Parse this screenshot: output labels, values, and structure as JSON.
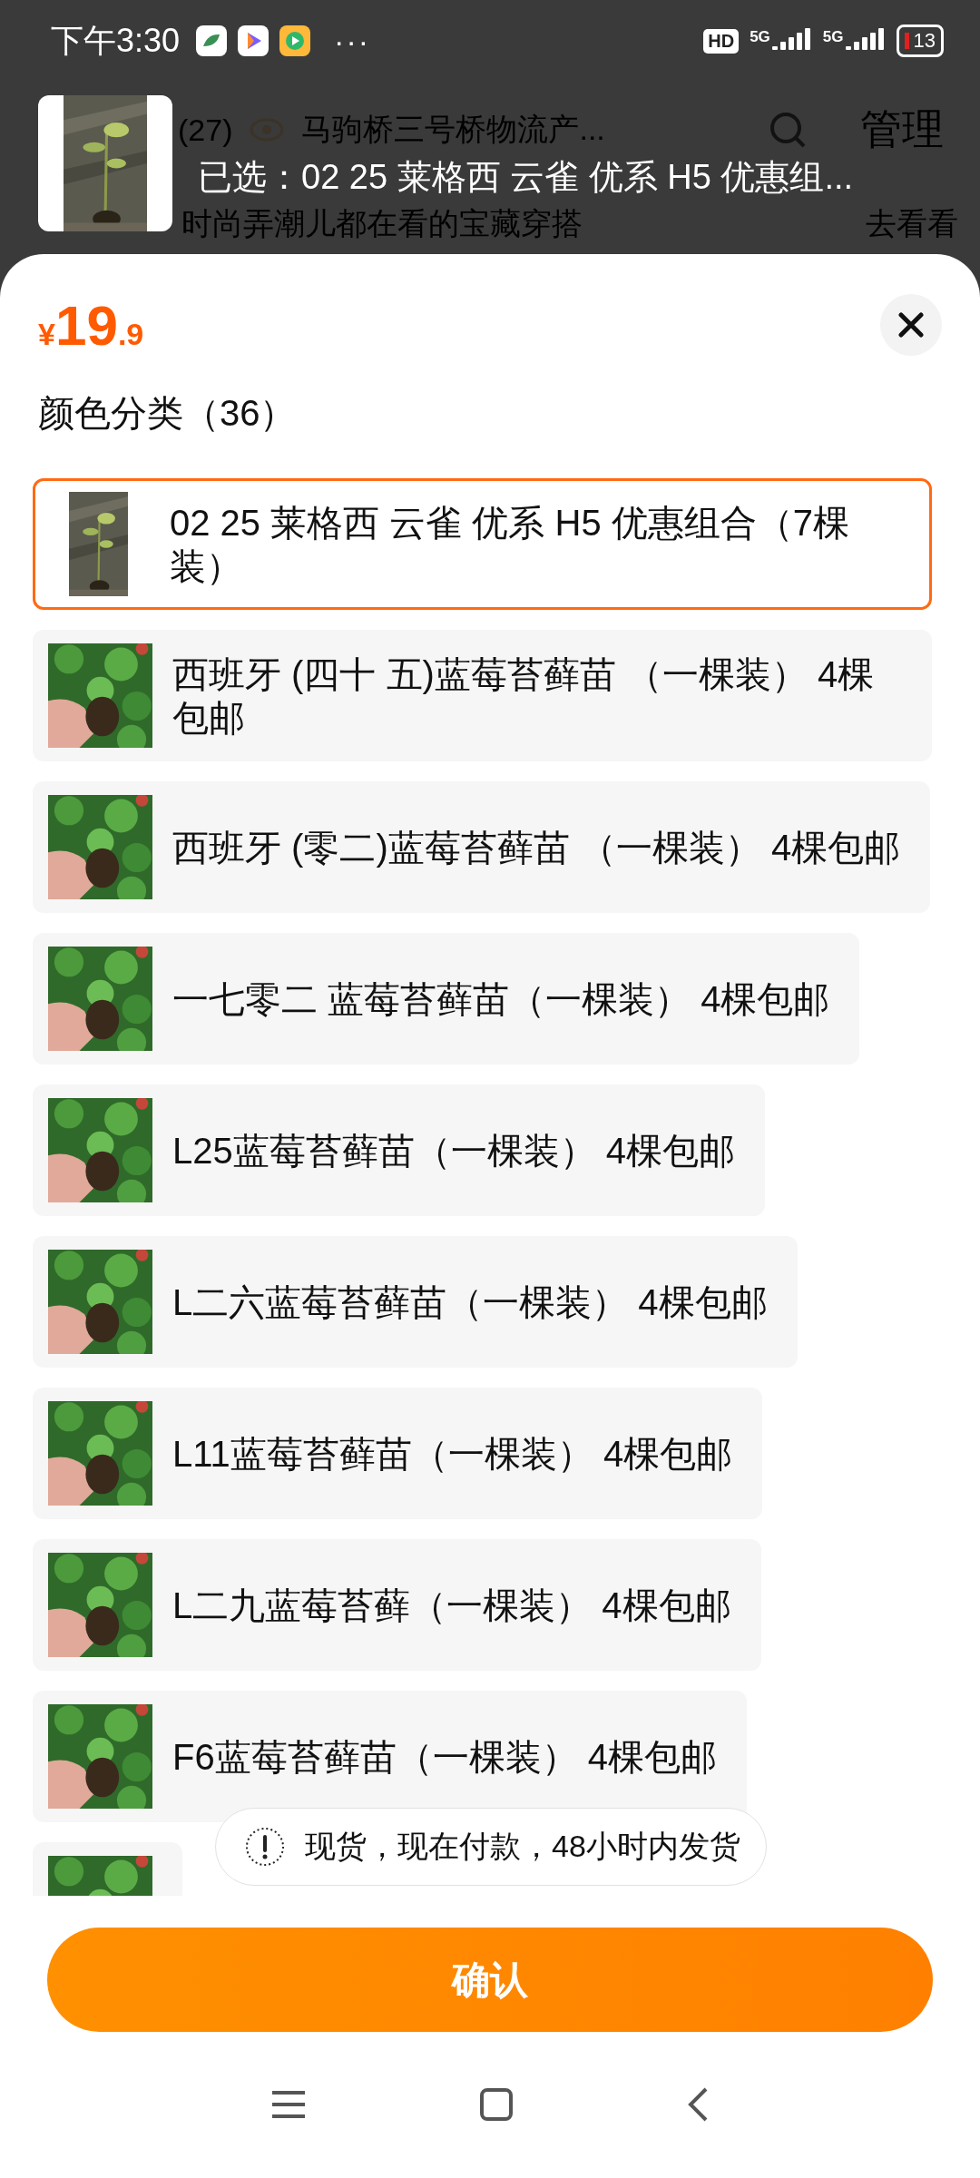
{
  "status_bar": {
    "time": "下午3:30",
    "more": "···",
    "hd": "HD",
    "signals": [
      "5G",
      "5G"
    ],
    "battery": "13"
  },
  "background_page": {
    "count": "(27)",
    "address": "马驹桥三号桥物流产...",
    "manage": "管理",
    "promo": "时尚弄潮儿都在看的宝藏穿搭",
    "promo_link": "去看看"
  },
  "selected_summary": "已选：02 25 莱格西 云雀 优系 H5 优惠组...",
  "price": {
    "currency": "¥",
    "integer": "19",
    "decimal": ".9"
  },
  "section_title": "颜色分类（36）",
  "options": [
    {
      "label": "02  25 莱格西 云雀 优系 H5 优惠组合（7棵装）",
      "selected": true
    },
    {
      "label": "西班牙 (四十 五)蓝莓苔藓苗 （一棵装） 4棵包邮",
      "selected": false
    },
    {
      "label": "西班牙 (零二)蓝莓苔藓苗 （一棵装） 4棵包邮",
      "selected": false
    },
    {
      "label": "一七零二 蓝莓苔藓苗（一棵装） 4棵包邮",
      "selected": false
    },
    {
      "label": "L25蓝莓苔藓苗（一棵装） 4棵包邮",
      "selected": false
    },
    {
      "label": "L二六蓝莓苔藓苗（一棵装） 4棵包邮",
      "selected": false
    },
    {
      "label": "L11蓝莓苔藓苗（一棵装） 4棵包邮",
      "selected": false
    },
    {
      "label": "L二九蓝莓苔藓（一棵装） 4棵包邮",
      "selected": false
    },
    {
      "label": "F6蓝莓苔藓苗（一棵装） 4棵包邮",
      "selected": false
    },
    {
      "selected": false
    }
  ],
  "toast": "现货，现在付款，48小时内发货",
  "confirm_button": "确认"
}
